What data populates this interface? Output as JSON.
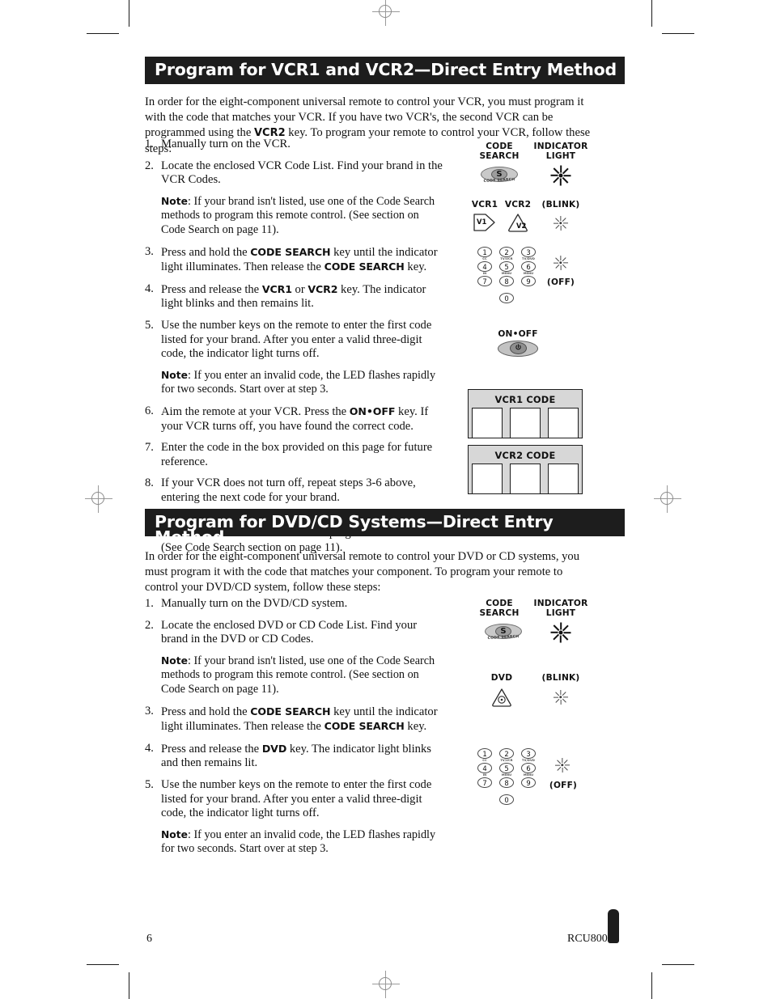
{
  "document": {
    "page_number": "6",
    "model": "RCU800"
  },
  "section1": {
    "heading": "Program for VCR1 and VCR2—Direct Entry Method",
    "intro_part1": "In order for the eight-component universal remote to control your VCR, you must program it with the code that matches your VCR. If you have two VCR's, the second VCR can be programmed using the ",
    "intro_bold": "VCR2",
    "intro_part2": " key. To program your remote to control your VCR, follow these steps:",
    "steps": [
      {
        "num": "1.",
        "text": "Manually turn on the VCR."
      },
      {
        "num": "2.",
        "text": "Locate the enclosed VCR Code List. Find your brand in the VCR Codes."
      }
    ],
    "note1_label": "Note",
    "note1_text": ": If your brand isn't listed, use one of the Code Search methods to program this remote control. (See section on Code Search on page 11).",
    "step3_num": "3.",
    "step3_a": "Press and hold the ",
    "step3_key1": "CODE SEARCH",
    "step3_b": " key until the indicator light illuminates. Then release the ",
    "step3_key2": "CODE SEARCH",
    "step3_c": " key.",
    "step4_num": "4.",
    "step4_a": "Press and release the ",
    "step4_key1": "VCR1",
    "step4_b": " or ",
    "step4_key2": "VCR2",
    "step4_c": " key. The indicator light blinks and then remains lit.",
    "step5_num": "5.",
    "step5_text": "Use the number keys on the remote to enter the first code listed for your brand. After you enter a valid three-digit code, the indicator light turns off.",
    "note2_label": "Note",
    "note2_text": ": If you enter an invalid code, the LED flashes rapidly for two seconds. Start over at step 3.",
    "step6_num": "6.",
    "step6_a": "Aim the remote at your VCR. Press the ",
    "step6_key1": "ON•OFF",
    "step6_b": " key. If your VCR turns off, you have found the correct code.",
    "step7_num": "7.",
    "step7_text": "Enter the code in the box provided on this page for future reference.",
    "step8_num": "8.",
    "step8_text": "If your VCR does not turn off, repeat steps 3-6 above, entering the next code for your brand.",
    "closing_text": "If none of the codes work or your brand is not listed, use one of the Code Search methods to program this remote. (See Code Search section on page 11).",
    "diagram": {
      "code_search_label_l1": "CODE",
      "code_search_label_l2": "SEARCH",
      "indicator_label_l1": "INDICATOR",
      "indicator_label_l2": "LIGHT",
      "cs_button_letter": "S",
      "cs_button_sub": "CODE SEARCH",
      "vcr1_label": "VCR1",
      "vcr2_label": "VCR2",
      "blink_label": "(BLINK)",
      "vcr1_key_text": "V1",
      "vcr2_key_text": "V2",
      "off_label": "(OFF)",
      "onoff_label": "ON•OFF"
    },
    "keypad": [
      {
        "n": "1",
        "sub": "CC"
      },
      {
        "n": "2",
        "sub": "TV/VCR"
      },
      {
        "n": "3",
        "sub": "TV/DVD"
      },
      {
        "n": "4",
        "sub": "IN"
      },
      {
        "n": "5",
        "sub": "MENU"
      },
      {
        "n": "6",
        "sub": "MENU"
      },
      {
        "n": "7",
        "sub": ""
      },
      {
        "n": "8",
        "sub": ""
      },
      {
        "n": "9",
        "sub": ""
      },
      {
        "n": "0",
        "sub": ""
      }
    ],
    "vcr1_code_box": {
      "title": "VCR1 CODE",
      "cells": [
        "",
        "",
        ""
      ]
    },
    "vcr2_code_box": {
      "title": "VCR2 CODE",
      "cells": [
        "",
        "",
        ""
      ]
    }
  },
  "section2": {
    "heading": "Program for DVD/CD Systems—Direct Entry Method",
    "intro": "In order for the eight-component universal remote to control your DVD or CD systems, you must program it with the code that matches your component. To program your remote to control your DVD/CD system, follow these steps:",
    "steps": [
      {
        "num": "1.",
        "text": "Manually turn on the DVD/CD system."
      },
      {
        "num": "2.",
        "text": "Locate the enclosed DVD or CD Code List. Find your brand in the DVD or CD Codes."
      }
    ],
    "note1_label": "Note",
    "note1_text": ": If your brand isn't listed, use one of the Code Search methods to program this remote control. (See section on Code Search on page 11).",
    "step3_num": "3.",
    "step3_a": "Press and hold the ",
    "step3_key1": "CODE SEARCH",
    "step3_b": " key until the indicator light illuminates. Then release the ",
    "step3_key2": "CODE SEARCH",
    "step3_c": " key.",
    "step4_num": "4.",
    "step4_a": "Press and release the ",
    "step4_key1": "DVD",
    "step4_b": " key. The indicator light blinks and then remains lit.",
    "step5_num": "5.",
    "step5_text": "Use the number keys on the remote to enter the first code listed for your brand. After you enter a valid three-digit code, the indicator light turns off.",
    "note2_label": "Note",
    "note2_text": ": If you enter an invalid code, the LED flashes rapidly for two seconds. Start over at step 3.",
    "diagram": {
      "code_search_label_l1": "CODE",
      "code_search_label_l2": "SEARCH",
      "indicator_label_l1": "INDICATOR",
      "indicator_label_l2": "LIGHT",
      "cs_button_letter": "S",
      "cs_button_sub": "CODE SEARCH",
      "dvd_label": "DVD",
      "blink_label": "(BLINK)",
      "off_label": "(OFF)"
    },
    "keypad": [
      {
        "n": "1",
        "sub": "CC"
      },
      {
        "n": "2",
        "sub": "TV/VCR"
      },
      {
        "n": "3",
        "sub": "TV/DVD"
      },
      {
        "n": "4",
        "sub": "IN"
      },
      {
        "n": "5",
        "sub": "MENU"
      },
      {
        "n": "6",
        "sub": "MENU"
      },
      {
        "n": "7",
        "sub": ""
      },
      {
        "n": "8",
        "sub": ""
      },
      {
        "n": "9",
        "sub": ""
      },
      {
        "n": "0",
        "sub": ""
      }
    ]
  }
}
